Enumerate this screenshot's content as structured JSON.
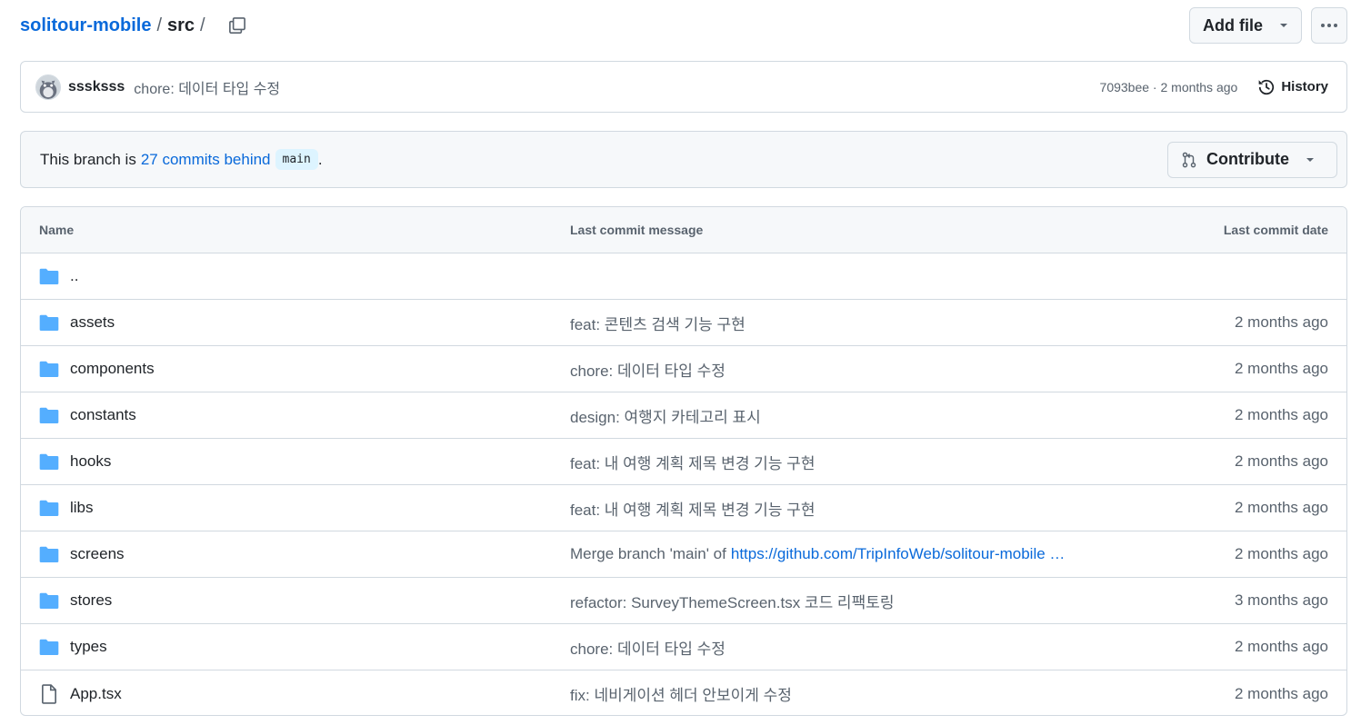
{
  "breadcrumb": {
    "repo": "solitour-mobile",
    "separator": "/",
    "dir": "src",
    "trailing_separator": "/"
  },
  "toolbar": {
    "add_file_label": "Add file",
    "more_label": "···"
  },
  "latest_commit": {
    "author": "sssksss",
    "message": "chore: 데이터 타입 수정",
    "meta": "7093bee · 2 months ago",
    "history_label": "History"
  },
  "branch_notice": {
    "prefix": "This branch is",
    "link": "27 commits behind",
    "branch": "main",
    "suffix": ".",
    "contribute_label": "Contribute"
  },
  "table": {
    "headers": {
      "name": "Name",
      "message": "Last commit message",
      "date": "Last commit date"
    },
    "rows": [
      {
        "type": "folder",
        "name": "..",
        "message": "",
        "link": "",
        "date": ""
      },
      {
        "type": "folder",
        "name": "assets",
        "message": "feat: 콘텐츠 검색 기능 구현",
        "link": "",
        "date": "2 months ago"
      },
      {
        "type": "folder",
        "name": "components",
        "message": "chore: 데이터 타입 수정",
        "link": "",
        "date": "2 months ago"
      },
      {
        "type": "folder",
        "name": "constants",
        "message": "design: 여행지 카테고리 표시",
        "link": "",
        "date": "2 months ago"
      },
      {
        "type": "folder",
        "name": "hooks",
        "message": "feat: 내 여행 계획 제목 변경 기능 구현",
        "link": "",
        "date": "2 months ago"
      },
      {
        "type": "folder",
        "name": "libs",
        "message": "feat: 내 여행 계획 제목 변경 기능 구현",
        "link": "",
        "date": "2 months ago"
      },
      {
        "type": "folder",
        "name": "screens",
        "message": "Merge branch 'main' of",
        "link": "https://github.com/TripInfoWeb/solitour-mobile …",
        "date": "2 months ago"
      },
      {
        "type": "folder",
        "name": "stores",
        "message": "refactor: SurveyThemeScreen.tsx 코드 리팩토링",
        "link": "",
        "date": "3 months ago"
      },
      {
        "type": "folder",
        "name": "types",
        "message": "chore: 데이터 타입 수정",
        "link": "",
        "date": "2 months ago"
      },
      {
        "type": "file",
        "name": "App.tsx",
        "message": "fix: 네비게이션 헤더 안보이게 수정",
        "link": "",
        "date": "2 months ago"
      }
    ]
  },
  "colors": {
    "link": "#0969da",
    "folder": "#54aeff",
    "muted": "#59636e",
    "border": "#d1d9e0"
  }
}
